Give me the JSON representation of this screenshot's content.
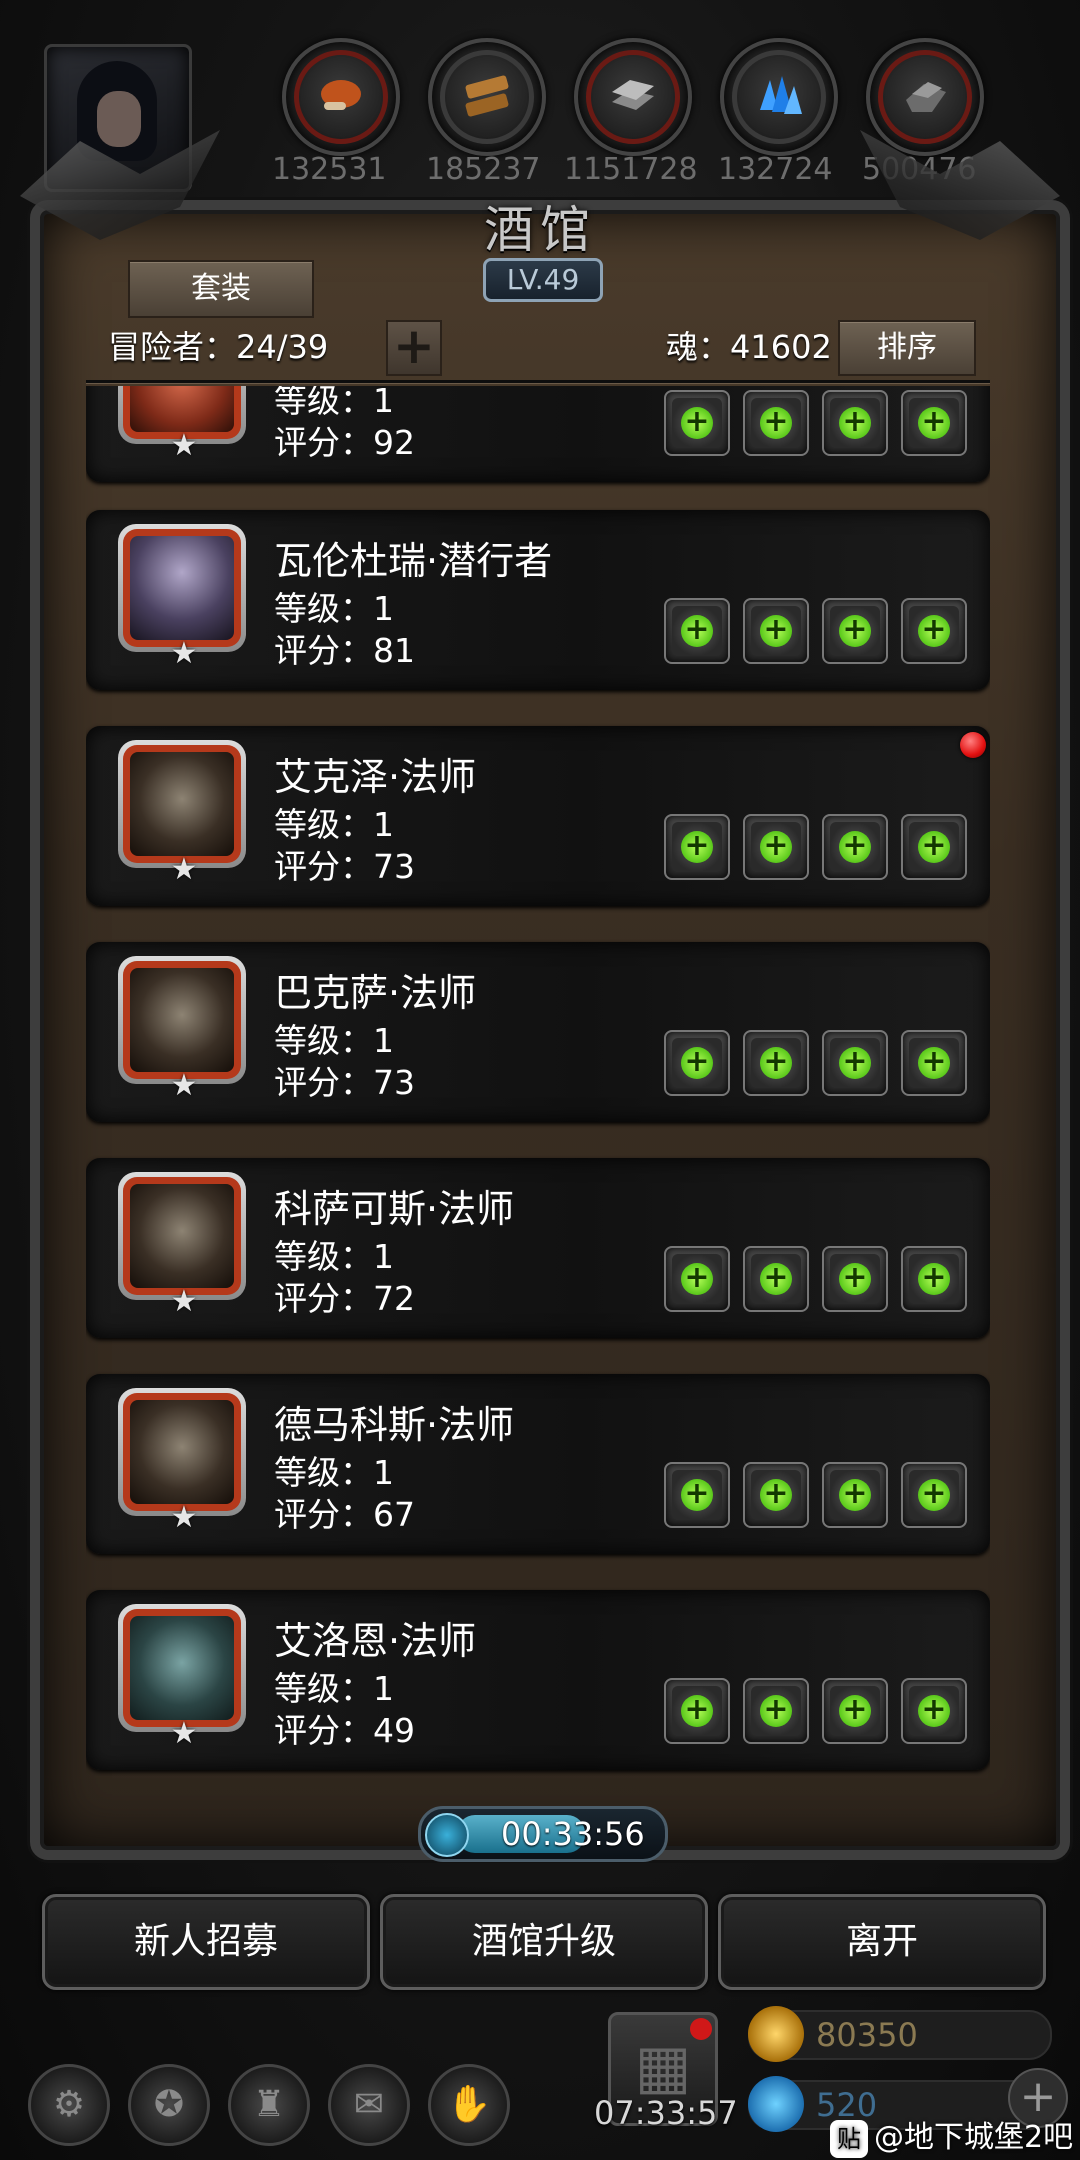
{
  "resources": {
    "values": [
      "132531",
      "185237",
      "1151728",
      "132724",
      "500476"
    ],
    "icons": [
      "meat-icon",
      "wood-icon",
      "iron-icon",
      "crystal-icon",
      "stone-icon"
    ]
  },
  "header": {
    "title": "酒馆",
    "level": "LV.49",
    "set_button": "套装",
    "adventurers": "冒险者：24/39",
    "add_button": "+",
    "soul": "魂：41602",
    "sort_button": "排序"
  },
  "heroes": [
    {
      "name": "",
      "level": "等级：1",
      "score": "评分：92",
      "portrait": "red"
    },
    {
      "name": "瓦伦杜瑞·潜行者",
      "level": "等级：1",
      "score": "评分：81",
      "portrait": "elf"
    },
    {
      "name": "艾克泽·法师",
      "level": "等级：1",
      "score": "评分：73",
      "portrait": "skull"
    },
    {
      "name": "巴克萨·法师",
      "level": "等级：1",
      "score": "评分：73",
      "portrait": "skull"
    },
    {
      "name": "科萨可斯·法师",
      "level": "等级：1",
      "score": "评分：72",
      "portrait": "skull"
    },
    {
      "name": "德马科斯·法师",
      "level": "等级：1",
      "score": "评分：67",
      "portrait": "skull"
    },
    {
      "name": "艾洛恩·法师",
      "level": "等级：1",
      "score": "评分：49",
      "portrait": "hood"
    }
  ],
  "timer": "00:33:56",
  "buttons": {
    "recruit": "新人招募",
    "upgrade": "酒馆升级",
    "leave": "离开"
  },
  "footer": {
    "gift_timer": "07:33:57",
    "gold": "80350",
    "gems": "520",
    "watermark_icon": "贴",
    "watermark": "@地下城堡2吧"
  }
}
